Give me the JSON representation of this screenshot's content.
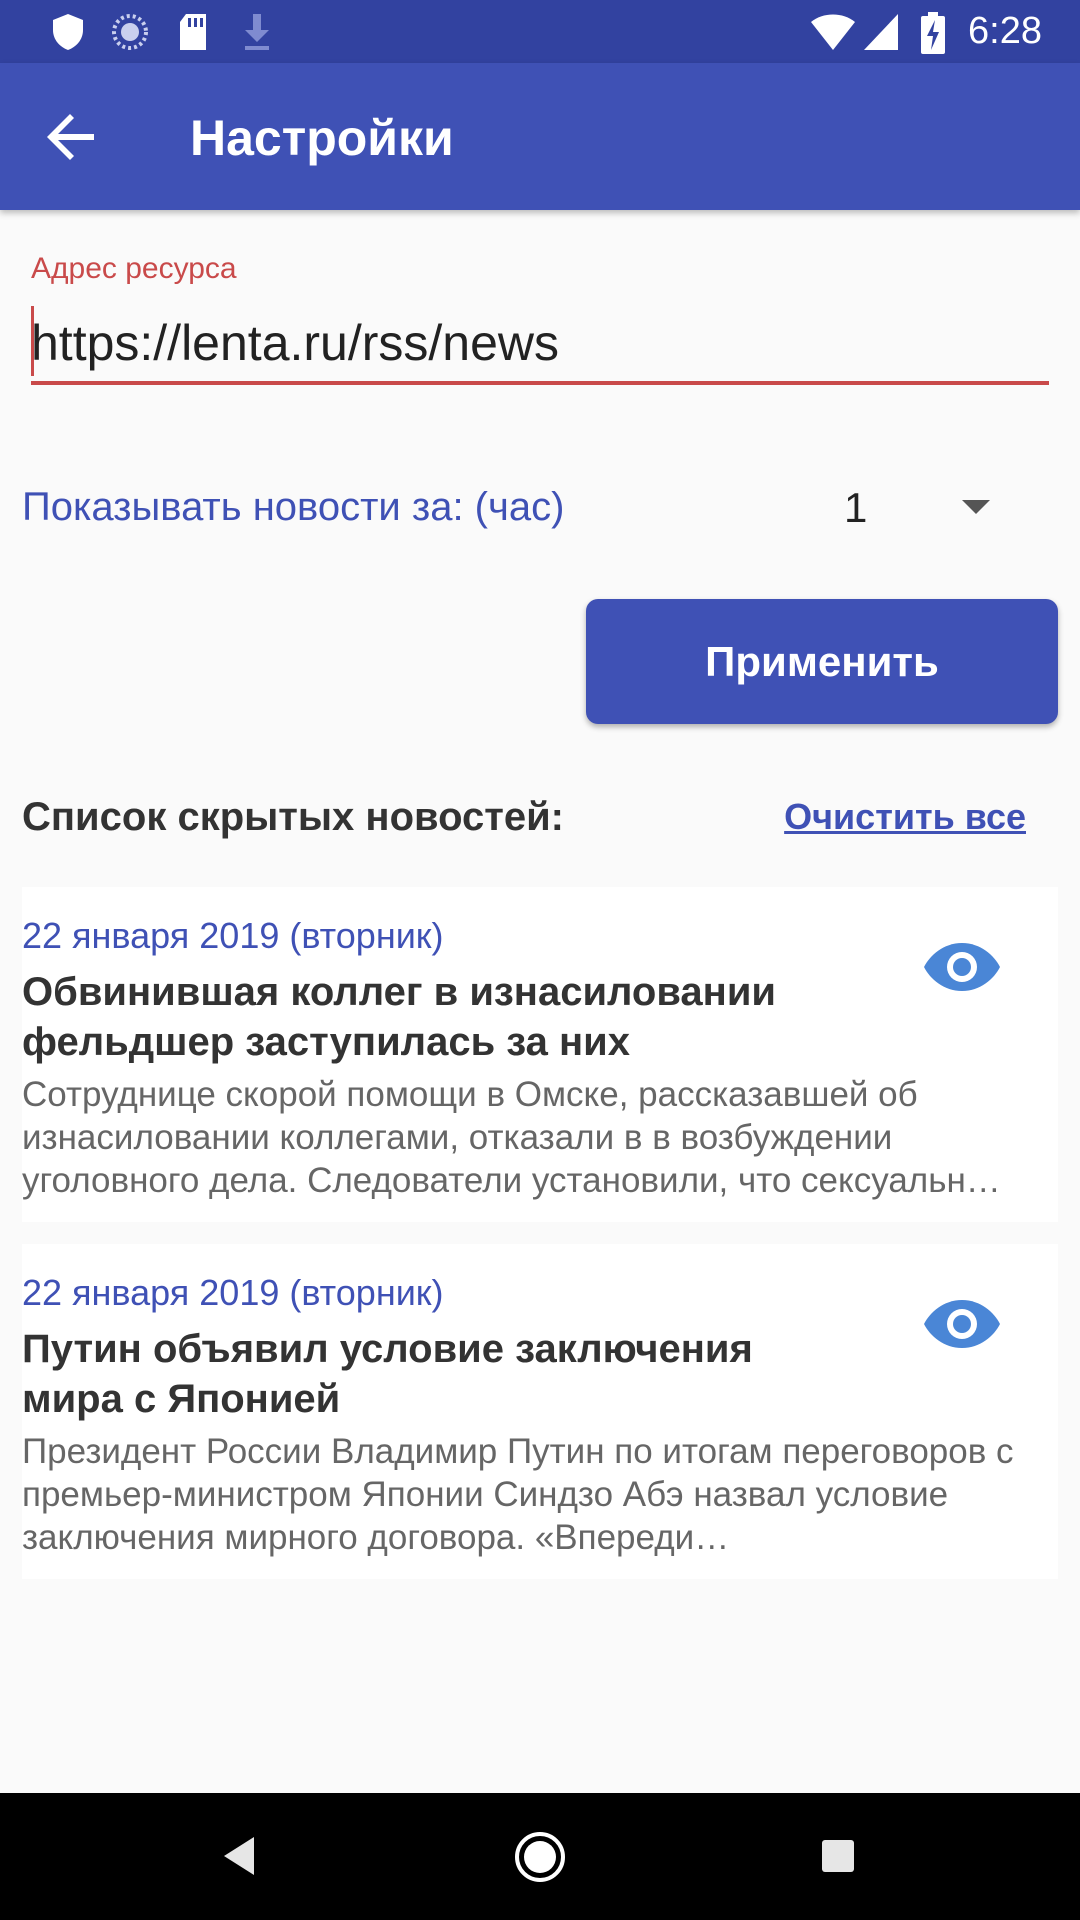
{
  "status_bar": {
    "time": "6:28",
    "icons": [
      "shield-icon",
      "sync-icon",
      "sd-card-icon",
      "download-icon",
      "wifi-icon",
      "signal-icon",
      "battery-charging-icon"
    ]
  },
  "app_bar": {
    "title": "Настройки",
    "back_icon": "arrow-left-icon"
  },
  "resource": {
    "label": "Адрес ресурса",
    "value": "https://lenta.ru/rss/news"
  },
  "period": {
    "label": "Показывать новости за: (час)",
    "selected": "1"
  },
  "apply_button": {
    "label": "Применить"
  },
  "hidden_list": {
    "title": "Список скрытых новостей:",
    "clear_label": "Очистить все",
    "items": [
      {
        "date": "22 января 2019 (вторник)",
        "headline": " Обвинившая коллег в изнасиловании фельдшер заступилась за них",
        "summary": " Сотруднице скорой помощи в Омске, рассказавшей об изнасиловании коллегами, отказали в в возбуждении уголовного дела. Следователи установили, что сексуальн…"
      },
      {
        "date": "22 января 2019 (вторник)",
        "headline": " Путин объявил условие заключения мира с Японией",
        "summary": " Президент России Владимир Путин по итогам переговоров с премьер-министром Японии Синдзо Абэ назвал условие заключения мирного договора. «Впереди…"
      }
    ]
  },
  "colors": {
    "primary": "#3f51b5",
    "status_bar": "#3242a0",
    "error": "#c94a4a"
  },
  "nav_bar": {
    "icons": [
      "back-triangle-icon",
      "home-circle-icon",
      "recents-square-icon"
    ]
  }
}
